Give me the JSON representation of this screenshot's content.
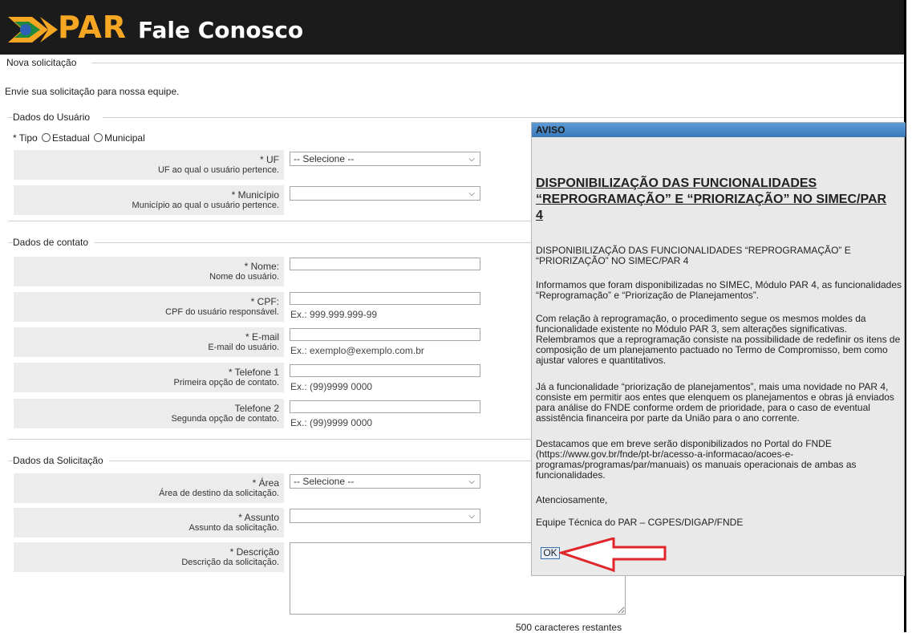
{
  "header": {
    "logo_text": "PAR",
    "title": "Fale Conosco"
  },
  "page": {
    "section_title": "Nova solicitação",
    "intro": "Envie sua solicitação para nossa equipe."
  },
  "user_section": {
    "legend": "Dados do Usuário",
    "tipo_label": "* Tipo",
    "tipo_options": [
      "Estadual",
      "Municipal"
    ],
    "uf": {
      "label": "* UF",
      "sub": "UF ao qual o usuário pertence.",
      "value": "-- Selecione --"
    },
    "municipio": {
      "label": "* Município",
      "sub": "Município ao qual o usuário pertence.",
      "value": ""
    }
  },
  "contact_section": {
    "legend": "Dados de contato",
    "nome": {
      "label": "* Nome:",
      "sub": "Nome do usuário.",
      "example": ""
    },
    "cpf": {
      "label": "* CPF:",
      "sub": "CPF do usuário responsável.",
      "example": "Ex.: 999.999.999-99"
    },
    "email": {
      "label": "* E-mail",
      "sub": "E-mail do usuário.",
      "example": "Ex.: exemplo@exemplo.com.br"
    },
    "telefone1": {
      "label": "* Telefone 1",
      "sub": "Primeira opção de contato.",
      "example": "Ex.: (99)9999 0000"
    },
    "telefone2": {
      "label": "Telefone 2",
      "sub": "Segunda opção de contato.",
      "example": "Ex.: (99)9999 0000"
    }
  },
  "request_section": {
    "legend": "Dados da Solicitação",
    "area": {
      "label": "* Área",
      "sub": "Área de destino da solicitação.",
      "value": "-- Selecione --"
    },
    "assunto": {
      "label": "* Assunto",
      "sub": "Assunto da solicitação.",
      "value": ""
    },
    "descricao": {
      "label": "* Descrição",
      "sub": "Descrição da solicitação."
    },
    "remaining": "500 caracteres restantes"
  },
  "modal": {
    "title": "AVISO",
    "heading": "DISPONIBILIZAÇÃO DAS FUNCIONALIDADES “REPROGRAMAÇÃO” E “PRIORIZAÇÃO” NO SIMEC/PAR 4",
    "p1": "DISPONIBILIZAÇÃO DAS FUNCIONALIDADES “REPROGRAMAÇÃO” E “PRIORIZAÇÃO” NO SIMEC/PAR 4",
    "p2": "Informamos que foram disponibilizadas no SIMEC, Módulo PAR 4, as funcionalidades “Reprogramação” e “Priorização de Planejamentos”.",
    "p3": "Com relação à reprogramação, o procedimento segue os mesmos moldes da funcionalidade existente no Módulo PAR 3, sem alterações significativas. Relembramos que a reprogramação consiste na possibilidade de redefinir os itens de composição de um planejamento pactuado no Termo de Compromisso, bem como ajustar valores e quantitativos.",
    "p4": "Já a funcionalidade “priorização de planejamentos”, mais uma novidade no PAR 4, consiste em permitir aos entes que elenquem os planejamentos e obras já enviados para análise do FNDE conforme ordem de prioridade, para o caso de eventual assistência financeira por parte da União para o ano corrente.",
    "p5": "Destacamos que em breve serão disponibilizados no Portal do FNDE (https://www.gov.br/fnde/pt-br/acesso-a-informacao/acoes-e-programas/programas/par/manuais) os manuais operacionais de ambas as funcionalidades.",
    "p6": "Atenciosamente,",
    "p7": "Equipe Técnica do PAR – CGPES/DIGAP/FNDE",
    "ok_label": "OK"
  },
  "colors": {
    "header_bg": "#1b1b1b",
    "logo_orange": "#f5a623",
    "modal_title_bg": "#3a7ab8",
    "arrow": "#e0262b"
  },
  "icons": [
    "chevron-down-icon",
    "par-logo-icon",
    "red-arrow-icon"
  ]
}
